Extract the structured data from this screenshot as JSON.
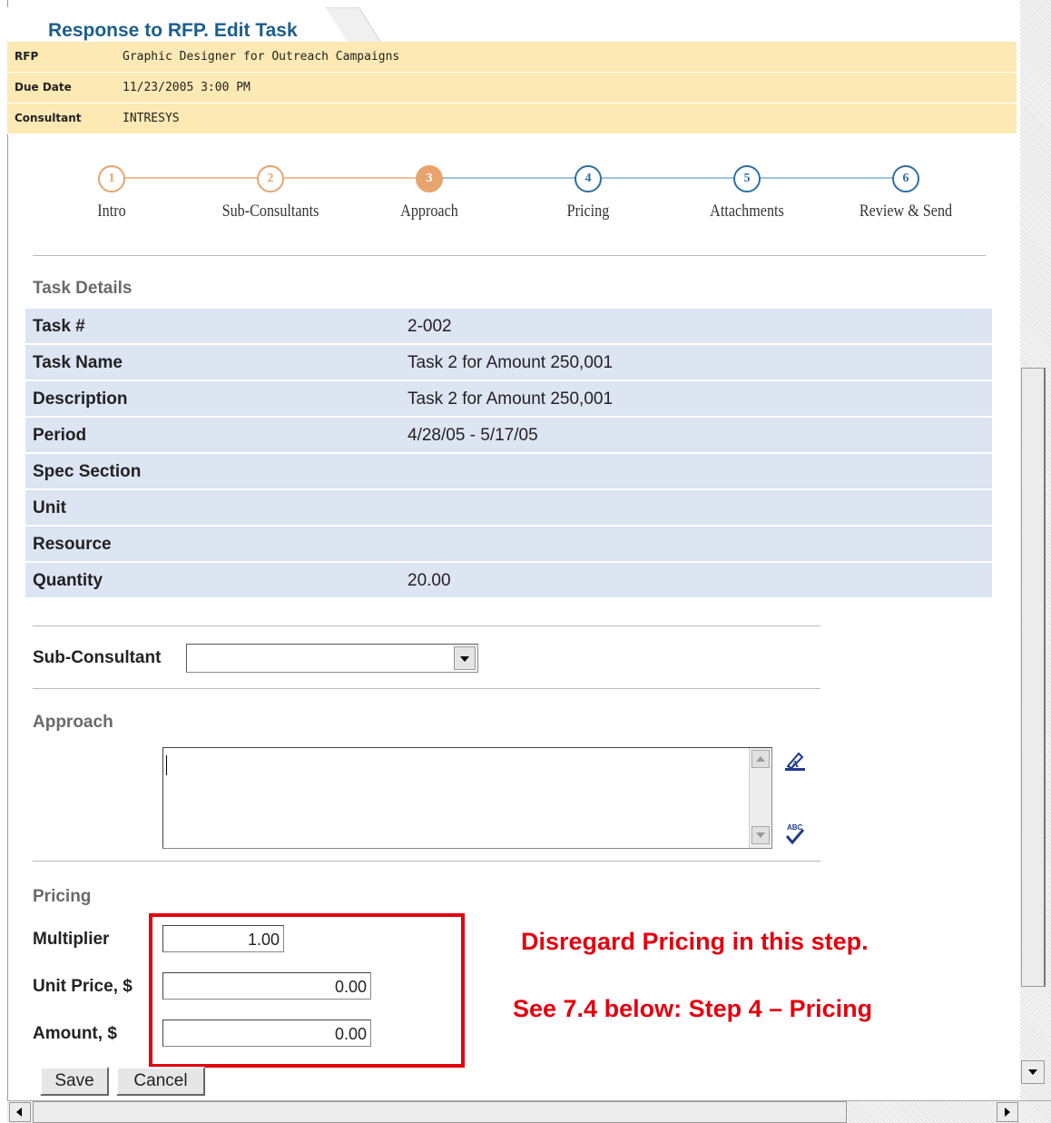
{
  "header": {
    "title": "Response to RFP. Edit Task"
  },
  "info": [
    {
      "label": "RFP",
      "value": "Graphic Designer for Outreach Campaigns"
    },
    {
      "label": "Due Date",
      "value": "11/23/2005 3:00 PM"
    },
    {
      "label": "Consultant",
      "value": "INTRESYS"
    }
  ],
  "steps": [
    {
      "num": "1",
      "label": "Intro",
      "state": "done"
    },
    {
      "num": "2",
      "label": "Sub-Consultants",
      "state": "done"
    },
    {
      "num": "3",
      "label": "Approach",
      "state": "current"
    },
    {
      "num": "4",
      "label": "Pricing",
      "state": "todo"
    },
    {
      "num": "5",
      "label": "Attachments",
      "state": "todo"
    },
    {
      "num": "6",
      "label": "Review & Send",
      "state": "todo"
    }
  ],
  "colors": {
    "done": "#e8a46e",
    "current": "#e8a46e",
    "todo": "#2e6fa3",
    "line_done": "#f0bf98",
    "line_todo": "#9cc3df",
    "accent_red": "#e3000f",
    "title_blue": "#1c5f8c"
  },
  "task_details": {
    "heading": "Task Details",
    "rows": [
      {
        "key": "Task #",
        "value": "2-002"
      },
      {
        "key": "Task Name",
        "value": "Task 2 for Amount 250,001"
      },
      {
        "key": "Description",
        "value": "Task 2 for Amount 250,001"
      },
      {
        "key": "Period",
        "value": "4/28/05 - 5/17/05"
      },
      {
        "key": "Spec Section",
        "value": ""
      },
      {
        "key": "Unit",
        "value": ""
      },
      {
        "key": "Resource",
        "value": ""
      },
      {
        "key": "Quantity",
        "value": "20.00"
      }
    ]
  },
  "sub_consultant": {
    "label": "Sub-Consultant",
    "value": ""
  },
  "approach": {
    "heading": "Approach",
    "value": ""
  },
  "pricing": {
    "heading": "Pricing",
    "multiplier_label": "Multiplier",
    "multiplier": "1.00",
    "unit_price_label": "Unit Price, $",
    "unit_price": "0.00",
    "amount_label": "Amount, $",
    "amount": "0.00"
  },
  "notes": {
    "line1": "Disregard Pricing in this step.",
    "line2": "See 7.4 below:  Step 4 – Pricing"
  },
  "buttons": {
    "save": "Save",
    "cancel": "Cancel"
  }
}
